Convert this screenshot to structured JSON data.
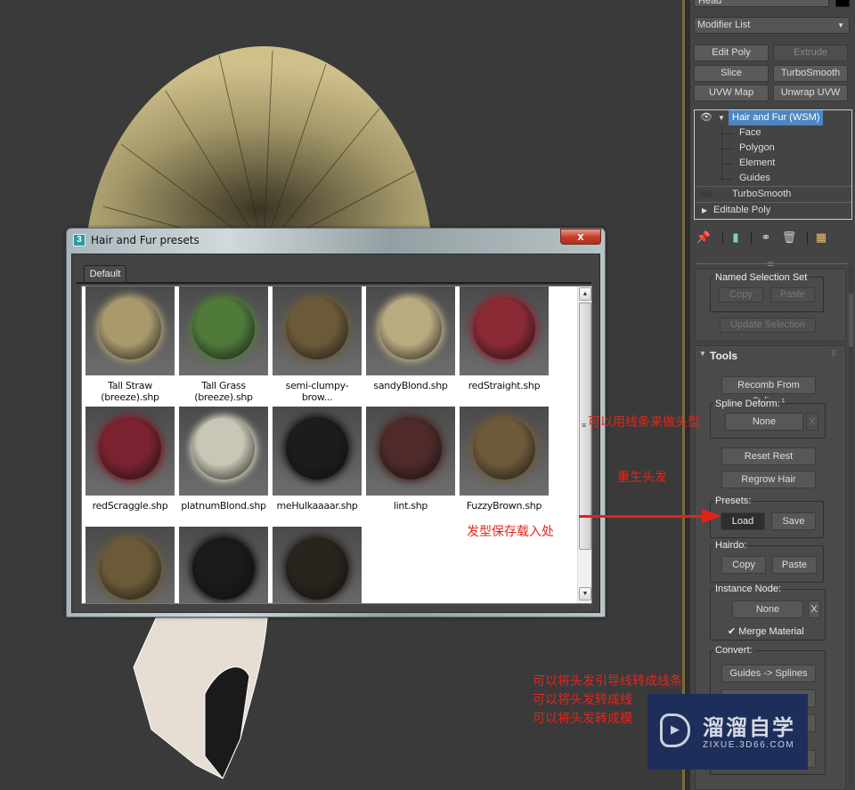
{
  "command_panel": {
    "object_name": "Head",
    "modifier_list": "Modifier List",
    "modifier_buttons": [
      {
        "label": "Edit Poly",
        "enabled": true
      },
      {
        "label": "Extrude",
        "enabled": false
      },
      {
        "label": "Slice",
        "enabled": true
      },
      {
        "label": "TurboSmooth",
        "enabled": true
      },
      {
        "label": "UVW Map",
        "enabled": true
      },
      {
        "label": "Unwrap UVW",
        "enabled": true
      }
    ],
    "stack": [
      {
        "label": "Hair and Fur (WSM)",
        "selected": true
      },
      {
        "label": "Face"
      },
      {
        "label": "Polygon"
      },
      {
        "label": "Element"
      },
      {
        "label": "Guides"
      },
      {
        "label": "TurboSmooth"
      },
      {
        "label": "Editable Poly"
      }
    ],
    "toolbar_icons": [
      "pin-stack-icon",
      "show-end-result-icon",
      "make-unique-icon",
      "remove-modifier-icon",
      "configure-modifier-sets-icon"
    ],
    "named_selection_set": {
      "label": "Named Selection Set",
      "copy": "Copy",
      "paste": "Paste",
      "update": "Update Selection"
    },
    "tools": {
      "title": "Tools",
      "recomb": "Recomb From Splines",
      "spline_deform_label": "Spline Deform:",
      "spline_deform_value": "None",
      "clear": "X",
      "reset_rest": "Reset Rest",
      "regrow_hair": "Regrow Hair",
      "presets_label": "Presets:",
      "load": "Load",
      "save": "Save",
      "hairdo_label": "Hairdo:",
      "hairdo_copy": "Copy",
      "hairdo_paste": "Paste",
      "instance_node_label": "Instance Node:",
      "instance_node_value": "None",
      "instance_clear": "X",
      "merge_material": "Merge Material",
      "merge_material_checked": true,
      "convert_label": "Convert:",
      "guides_to_splines": "Guides -> Splines"
    }
  },
  "dialog": {
    "title": "Hair and Fur presets",
    "close": "x",
    "tab": "Default",
    "presets": [
      {
        "label": "Tall Straw (breeze).shp",
        "color": "#a99a6e"
      },
      {
        "label": "Tall Grass (breeze).shp",
        "color": "#4f7a3a"
      },
      {
        "label": "semi-clumpy-brow...",
        "color": "#6b5a3a"
      },
      {
        "label": "sandyBlond.shp",
        "color": "#b8ab80"
      },
      {
        "label": "redStraight.shp",
        "color": "#8a2a35"
      },
      {
        "label": "redScraggle.shp",
        "color": "#7a2230"
      },
      {
        "label": "platnumBlond.shp",
        "color": "#c8c6b4"
      },
      {
        "label": "meHulkaaaar.shp",
        "color": "#1c1c1c"
      },
      {
        "label": "lint.shp",
        "color": "#4e2a2a"
      },
      {
        "label": "FuzzyBrown.shp",
        "color": "#6e5a3a"
      },
      {
        "label": "",
        "color": "#6a5a38"
      },
      {
        "label": "",
        "color": "#1a1a1a"
      },
      {
        "label": "",
        "color": "#2a241e"
      }
    ]
  },
  "annotations": {
    "spline_hint": "可以用线条来做头型",
    "regrow_hint": "重生头发",
    "presets_hint": "发型保存载入处",
    "convert_hints": [
      "可以将头发引导线转成线条",
      "可以将头发转成线",
      "可以将头发转成模"
    ]
  },
  "watermark": {
    "title": "溜溜自学",
    "url": "ZIXUE.3D66.COM"
  }
}
